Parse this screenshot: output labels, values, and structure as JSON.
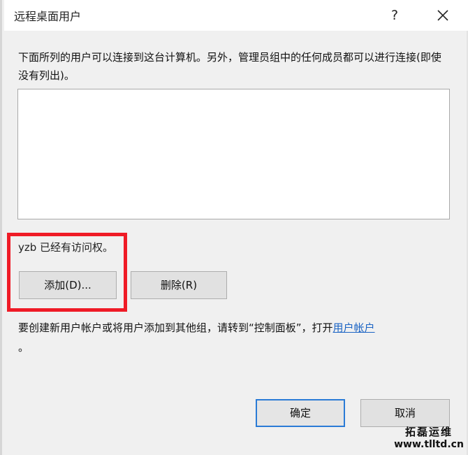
{
  "window": {
    "title": "远程桌面用户",
    "help_label": "?",
    "close_icon": "close-icon"
  },
  "main": {
    "description": "下面所列的用户可以连接到这台计算机。另外，管理员组中的任何成员都可以进行连接(即使没有列出)。",
    "user_list_items": [],
    "access_status": "yzb 已经有访问权。",
    "add_button_label": "添加(D)...",
    "remove_button_label": "删除(R)",
    "hint_prefix": "要创建新用户帐户或将用户添加到其他组，请转到“控制面板”，打开",
    "hint_link": "用户帐户",
    "hint_suffix": "。"
  },
  "footer": {
    "ok_label": "确定",
    "cancel_label": "取消"
  },
  "watermark": {
    "name": "拓磊运维",
    "url": "www.tlltd.cn"
  },
  "colors": {
    "highlight": "#ef1b26",
    "link": "#1a63c4",
    "focus_border": "#2a7bd6"
  }
}
